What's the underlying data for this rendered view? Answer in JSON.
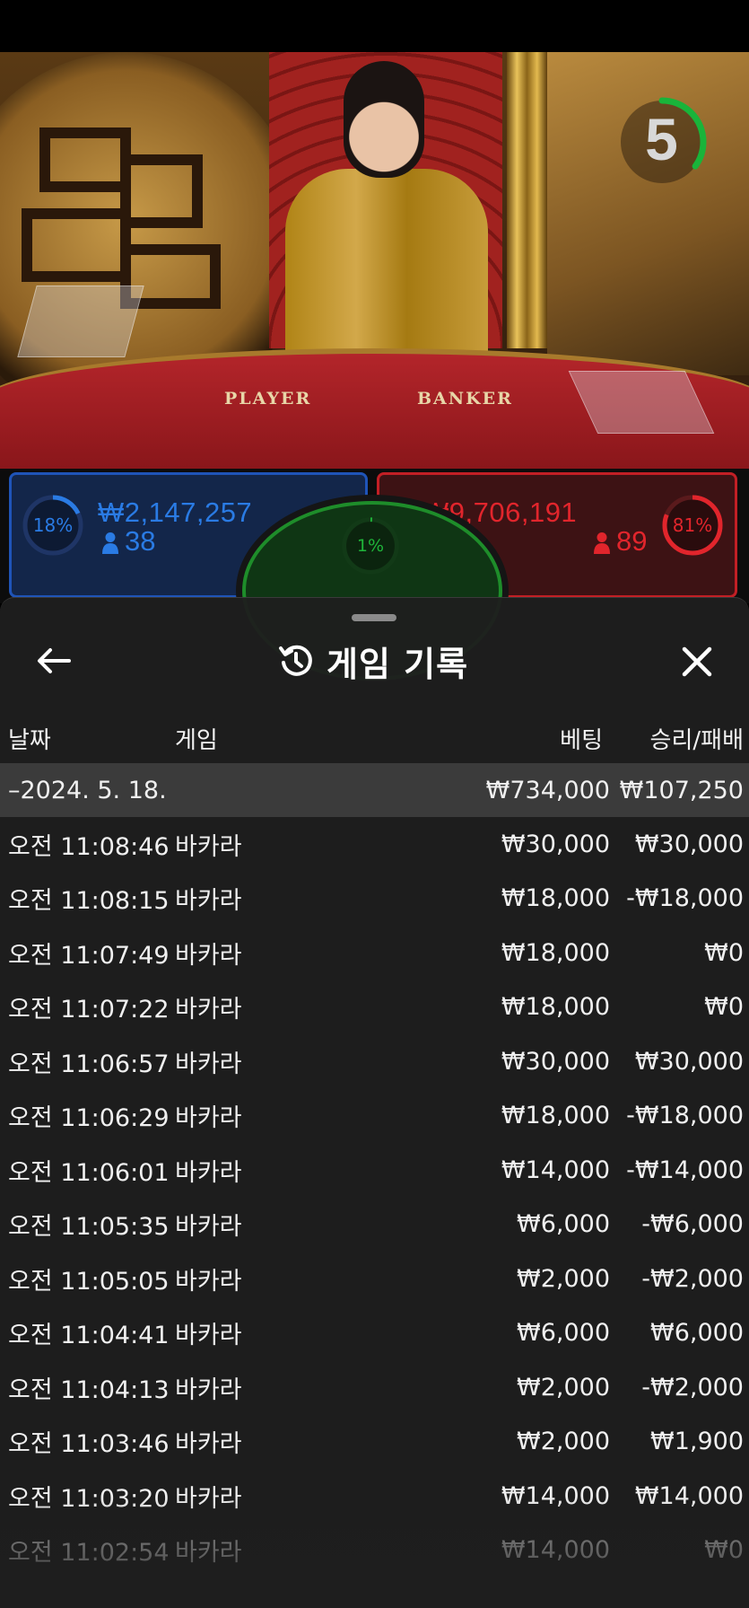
{
  "timer": {
    "value": "5",
    "progress_fraction": 0.35,
    "color": "#19b43a"
  },
  "table": {
    "player_label": "PLAYER",
    "banker_label": "BANKER"
  },
  "bets": {
    "player": {
      "percent": "18%",
      "amount": "₩2,147,257",
      "count": "38",
      "color": "#2a7be4"
    },
    "tie": {
      "percent": "1%",
      "color": "#1fb53a"
    },
    "banker": {
      "percent": "81%",
      "amount": "₩9,706,191",
      "count": "89",
      "color": "#e1252c"
    }
  },
  "history": {
    "title": "게임 기록",
    "columns": {
      "date": "날짜",
      "game": "게임",
      "bet": "베팅",
      "result": "승리/패배"
    },
    "summary": {
      "date": "–2024. 5. 18.",
      "bet": "₩734,000",
      "result": "₩107,250"
    },
    "rows": [
      {
        "time": "오전 11:08:46",
        "game": "바카라",
        "bet": "₩30,000",
        "result": "₩30,000"
      },
      {
        "time": "오전 11:08:15",
        "game": "바카라",
        "bet": "₩18,000",
        "result": "-₩18,000"
      },
      {
        "time": "오전 11:07:49",
        "game": "바카라",
        "bet": "₩18,000",
        "result": "₩0"
      },
      {
        "time": "오전 11:07:22",
        "game": "바카라",
        "bet": "₩18,000",
        "result": "₩0"
      },
      {
        "time": "오전 11:06:57",
        "game": "바카라",
        "bet": "₩30,000",
        "result": "₩30,000"
      },
      {
        "time": "오전 11:06:29",
        "game": "바카라",
        "bet": "₩18,000",
        "result": "-₩18,000"
      },
      {
        "time": "오전 11:06:01",
        "game": "바카라",
        "bet": "₩14,000",
        "result": "-₩14,000"
      },
      {
        "time": "오전 11:05:35",
        "game": "바카라",
        "bet": "₩6,000",
        "result": "-₩6,000"
      },
      {
        "time": "오전 11:05:05",
        "game": "바카라",
        "bet": "₩2,000",
        "result": "-₩2,000"
      },
      {
        "time": "오전 11:04:41",
        "game": "바카라",
        "bet": "₩6,000",
        "result": "₩6,000"
      },
      {
        "time": "오전 11:04:13",
        "game": "바카라",
        "bet": "₩2,000",
        "result": "-₩2,000"
      },
      {
        "time": "오전 11:03:46",
        "game": "바카라",
        "bet": "₩2,000",
        "result": "₩1,900"
      },
      {
        "time": "오전 11:03:20",
        "game": "바카라",
        "bet": "₩14,000",
        "result": "₩14,000"
      },
      {
        "time": "오전 11:02:54",
        "game": "바카라",
        "bet": "₩14,000",
        "result": "₩0"
      }
    ]
  },
  "icons": {
    "back": "arrow-left-icon",
    "history": "history-clock-icon",
    "close": "close-icon",
    "user": "person-icon"
  }
}
